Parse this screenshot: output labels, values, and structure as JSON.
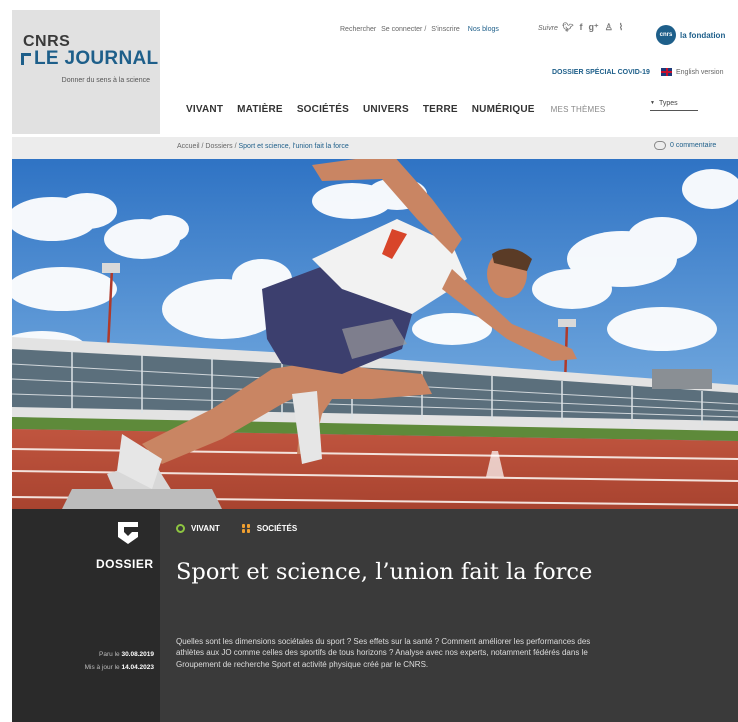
{
  "logo": {
    "line1": "CNRS",
    "line2": "LE JOURNAL",
    "tagline": "Donner du sens à la science"
  },
  "topbar": {
    "search": "Rechercher",
    "login": "Se connecter /",
    "register": "S'inscrire",
    "blogs": "Nos blogs",
    "follow": "Suivre",
    "social_icons": [
      "twitter-icon",
      "facebook-icon",
      "googleplus-icon",
      "person-icon",
      "rss-icon"
    ],
    "fondation_badge": "cnrs",
    "fondation": "la fondation"
  },
  "covid_link": "DOSSIER SPÉCIAL COVID-19",
  "english_link": "English version",
  "nav": {
    "items": [
      "VIVANT",
      "MATIÈRE",
      "SOCIÉTÉS",
      "UNIVERS",
      "TERRE",
      "NUMÉRIQUE"
    ],
    "themes": "MES THÈMES",
    "types": "Types"
  },
  "breadcrumb": {
    "home": "Accueil /",
    "section": "Dossiers /",
    "current": "Sport et science, l'union fait la force"
  },
  "comments": "0 commentaire",
  "article": {
    "kind": "DOSSIER",
    "published_label": "Paru le",
    "published": "30.08.2019",
    "updated_label": "Mis à jour le",
    "updated": "14.04.2023",
    "tags": [
      "VIVANT",
      "SOCIÉTÉS"
    ],
    "title": "Sport et science, l’union fait la force",
    "intro": "Quelles sont les dimensions sociétales du sport ? Ses effets sur la santé ? Comment améliorer les performances des athlètes aux JO comme celles des sportifs de tous horizons ? Analyse avec nos experts, notamment fédérés dans le Groupement de recherche Sport et activité physique créé par le CNRS."
  },
  "colors": {
    "brand_blue": "#1e5f8a",
    "vivant_green": "#8ec641",
    "societes_orange": "#f0a030",
    "band_dark": "#3a3a3a",
    "band_darker": "#2a2a2a"
  }
}
